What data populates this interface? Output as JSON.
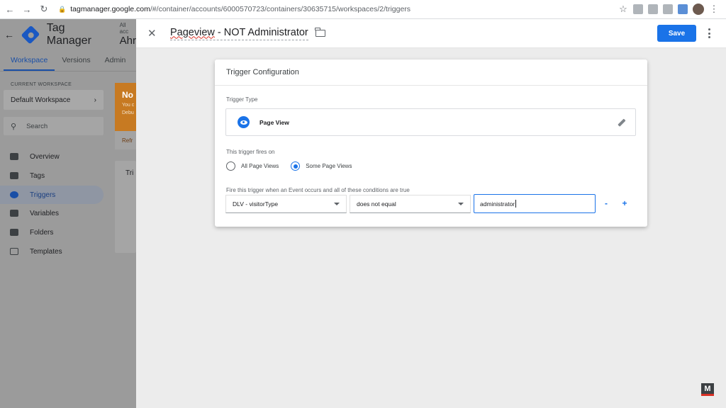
{
  "browser": {
    "url_host": "tagmanager.google.com",
    "url_path": "/#/container/accounts/6000570723/containers/30635715/workspaces/2/triggers"
  },
  "app": {
    "title": "Tag Manager",
    "account_small": "All acc",
    "account_big": "Ahr",
    "tabs": [
      "Workspace",
      "Versions",
      "Admin"
    ]
  },
  "sidebar": {
    "current_workspace_label": "CURRENT WORKSPACE",
    "workspace_name": "Default Workspace",
    "search_placeholder": "Search",
    "items": [
      {
        "label": "Overview",
        "icon": "overview-icon"
      },
      {
        "label": "Tags",
        "icon": "tag-icon"
      },
      {
        "label": "Triggers",
        "icon": "trigger-icon"
      },
      {
        "label": "Variables",
        "icon": "variables-icon"
      },
      {
        "label": "Folders",
        "icon": "folder-icon"
      },
      {
        "label": "Templates",
        "icon": "template-icon"
      }
    ],
    "active_item": "Triggers"
  },
  "background": {
    "notice_title": "No",
    "notice_line1": "You c",
    "notice_line2": "Debu",
    "refresh_text": "Refr",
    "card_title": "Tri"
  },
  "panel": {
    "title_part1": "Pageview",
    "title_part2": " - NOT Administrator",
    "save_label": "Save"
  },
  "config": {
    "card_title": "Trigger Configuration",
    "trigger_type_label": "Trigger Type",
    "trigger_type_name": "Page View",
    "fires_on_label": "This trigger fires on",
    "option_all": "All Page Views",
    "option_some": "Some Page Views",
    "selected_option": "Some Page Views",
    "conditions_label": "Fire this trigger when an Event occurs and all of these conditions are true",
    "condition": {
      "variable": "DLV - visitorType",
      "operator": "does not equal",
      "value": "administrator"
    },
    "remove_label": "-",
    "add_label": "+"
  },
  "colors": {
    "accent": "#1a73e8",
    "notice": "#c77a22"
  }
}
